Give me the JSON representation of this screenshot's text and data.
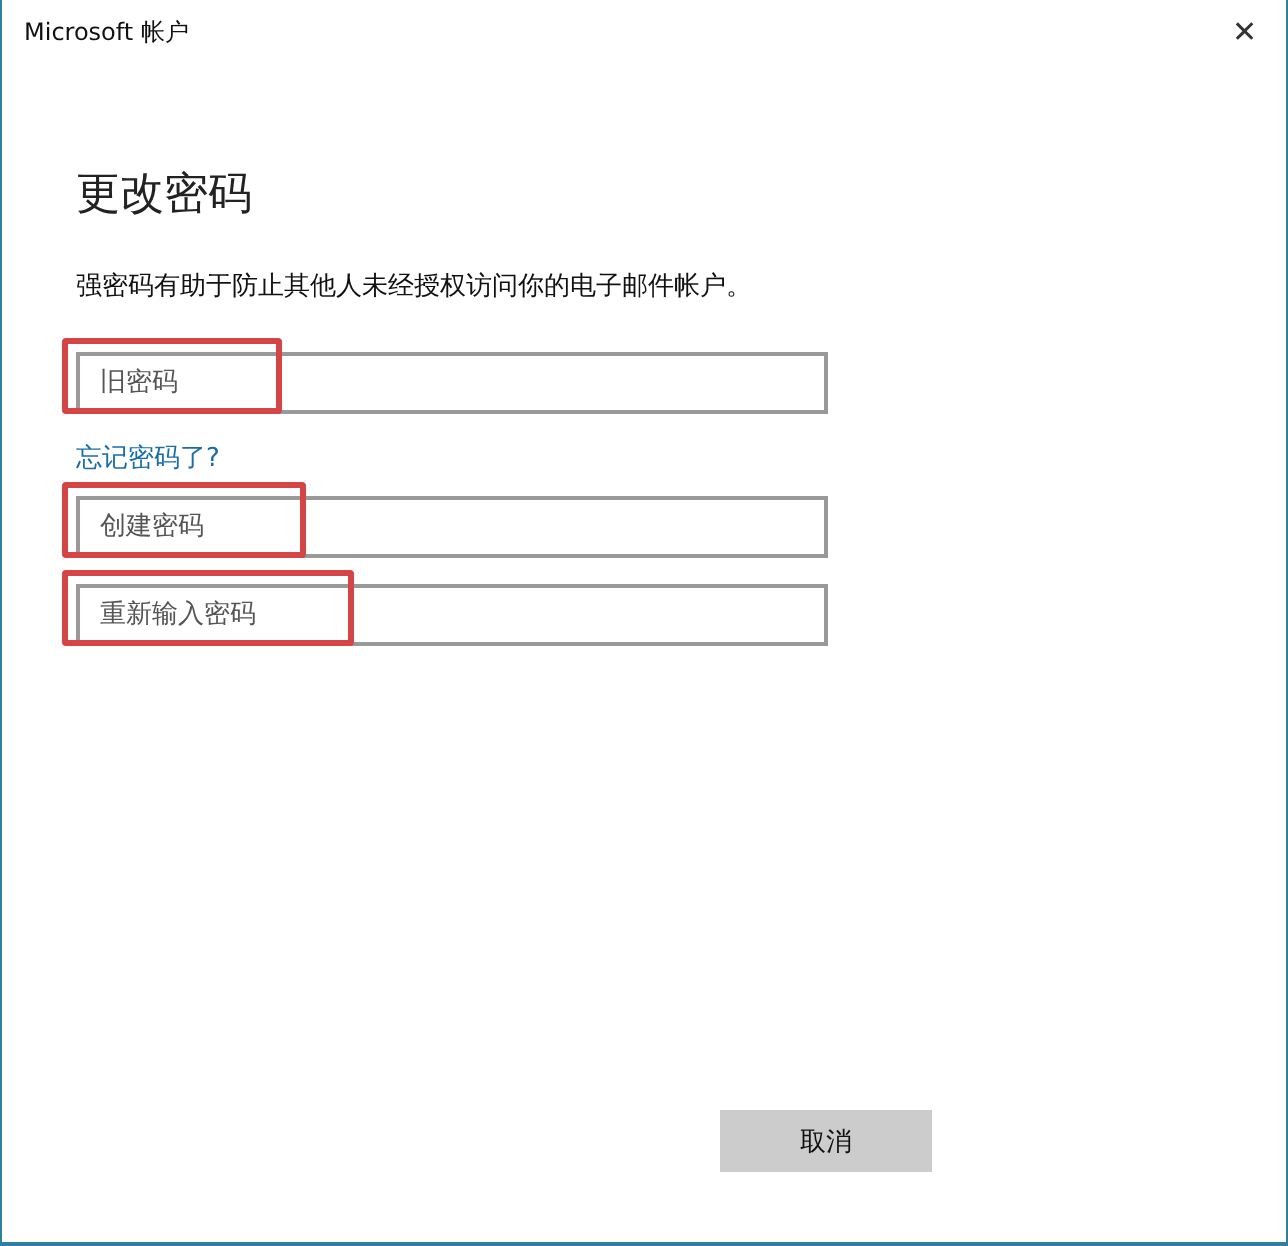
{
  "window": {
    "title": "Microsoft 帐户",
    "close": "✕"
  },
  "heading": "更改密码",
  "description": "强密码有助于防止其他人未经授权访问你的电子邮件帐户。",
  "fields": [
    {
      "placeholder": "旧密码",
      "highlighted": true
    },
    {
      "kind": "link",
      "text": "忘记密码了?"
    },
    {
      "placeholder": "创建密码",
      "highlighted": true
    },
    {
      "placeholder": "重新输入密码",
      "highlighted": true
    }
  ],
  "buttons": [
    "取消"
  ]
}
